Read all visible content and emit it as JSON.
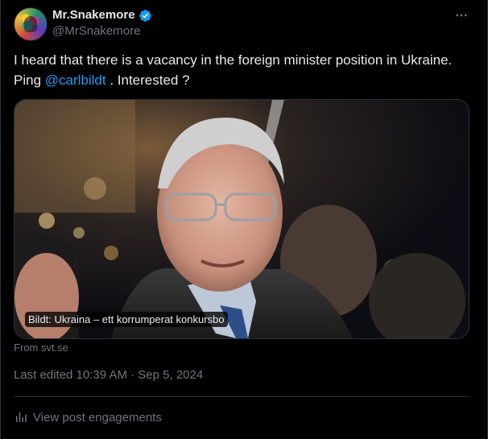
{
  "author": {
    "display_name": "Mr.Snakemore",
    "handle": "@MrSnakemore",
    "verified": true
  },
  "tweet": {
    "text_1": "I heard that there is a vacancy in the foreign minister position in Ukraine. Ping ",
    "mention": "@carlbildt",
    "text_2": " . Interested ?"
  },
  "media": {
    "caption": "Bildt: Ukraina – ett korrumperat konkursbo",
    "source": "From svt.se"
  },
  "meta": {
    "edited_label": "Last edited",
    "time": "10:39 AM",
    "separator": "·",
    "date": "Sep 5, 2024"
  },
  "actions": {
    "engagements_label": "View post engagements"
  },
  "colors": {
    "accent": "#1d9bf0",
    "background": "#000000",
    "text": "#e7e9ea",
    "secondary_text": "#71767b",
    "border": "#2f3336"
  },
  "icons": {
    "verified": "verified-badge-icon",
    "more": "more-dots-icon",
    "engagements": "bar-chart-icon"
  }
}
